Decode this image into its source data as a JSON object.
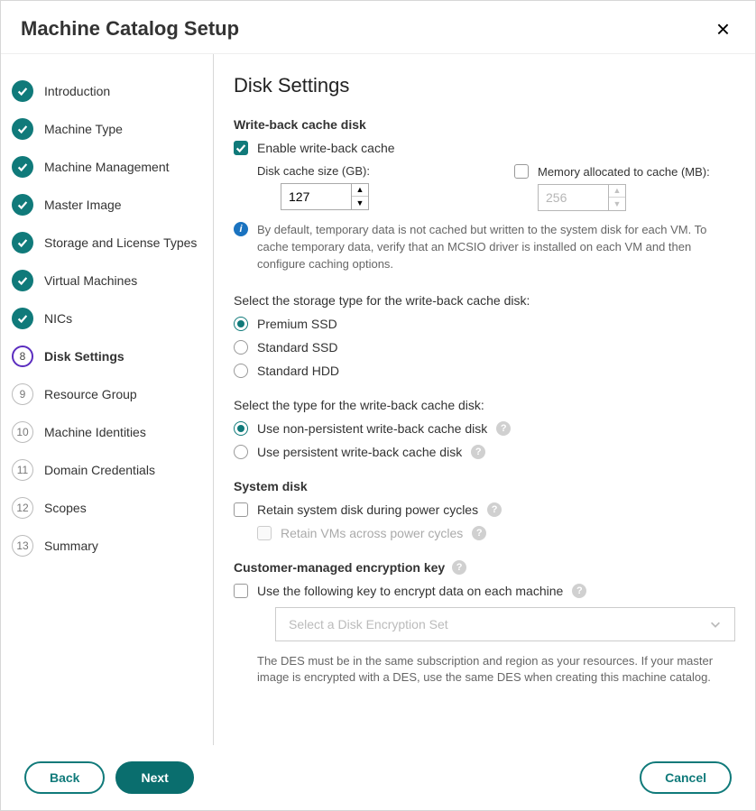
{
  "header": {
    "title": "Machine Catalog Setup"
  },
  "steps": [
    {
      "label": "Introduction",
      "state": "done"
    },
    {
      "label": "Machine Type",
      "state": "done"
    },
    {
      "label": "Machine Management",
      "state": "done"
    },
    {
      "label": "Master Image",
      "state": "done"
    },
    {
      "label": "Storage and License Types",
      "state": "done"
    },
    {
      "label": "Virtual Machines",
      "state": "done"
    },
    {
      "label": "NICs",
      "state": "done"
    },
    {
      "label": "Disk Settings",
      "state": "current"
    },
    {
      "label": "Resource Group",
      "state": "pending"
    },
    {
      "label": "Machine Identities",
      "state": "pending"
    },
    {
      "label": "Domain Credentials",
      "state": "pending"
    },
    {
      "label": "Scopes",
      "state": "pending"
    },
    {
      "label": "Summary",
      "state": "pending"
    }
  ],
  "page": {
    "title": "Disk Settings",
    "writeback": {
      "section_title": "Write-back cache disk",
      "enable_label": "Enable write-back cache",
      "enable_checked": true,
      "disk_size_label": "Disk cache size (GB):",
      "disk_size_value": "127",
      "memory_label": "Memory allocated to cache (MB):",
      "memory_checked": false,
      "memory_value": "256",
      "info_text": "By default, temporary data is not cached but written to the system disk for each VM. To cache temporary data, verify that an MCSIO driver is installed on each VM and then configure caching options.",
      "storage_type_label": "Select the storage type for the write-back cache disk:",
      "storage_options": [
        {
          "label": "Premium SSD",
          "checked": true
        },
        {
          "label": "Standard SSD",
          "checked": false
        },
        {
          "label": "Standard HDD",
          "checked": false
        }
      ],
      "persist_type_label": "Select the type for the write-back cache disk:",
      "persist_options": [
        {
          "label": "Use non-persistent write-back cache disk",
          "checked": true,
          "help": true
        },
        {
          "label": "Use persistent write-back cache disk",
          "checked": false,
          "help": true
        }
      ]
    },
    "systemdisk": {
      "section_title": "System disk",
      "retain_label": "Retain system disk during power cycles",
      "retain_checked": false,
      "retain_vms_label": "Retain VMs across power cycles",
      "retain_vms_disabled": true
    },
    "cme": {
      "section_title": "Customer-managed encryption key",
      "use_key_label": "Use the following key to encrypt data on each machine",
      "use_key_checked": false,
      "select_placeholder": "Select a Disk Encryption Set",
      "desc": "The DES must be in the same subscription and region as your resources. If your master image is encrypted with a DES, use the same DES when creating this machine catalog."
    }
  },
  "footer": {
    "back": "Back",
    "next": "Next",
    "cancel": "Cancel"
  }
}
